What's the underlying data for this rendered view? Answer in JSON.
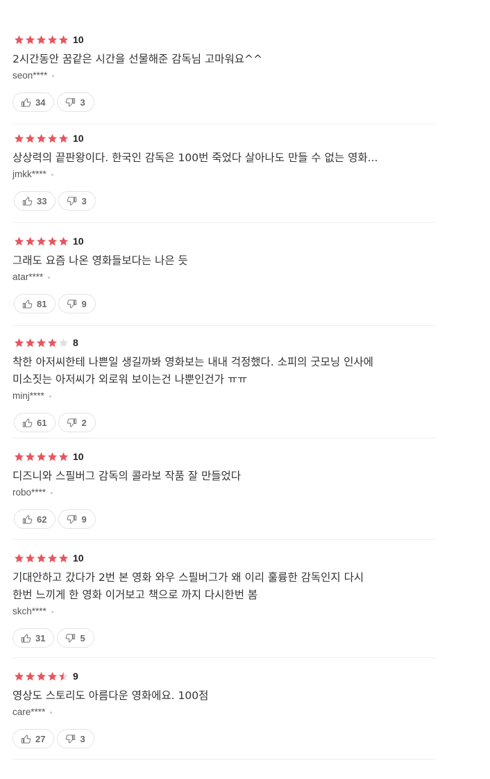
{
  "colors": {
    "star_filled": "#e8555f",
    "star_empty": "#dcdfe3",
    "divider": "#eeeeee",
    "text": "#333333"
  },
  "reviews": [
    {
      "rating_stars": 5,
      "score": "10",
      "text_lines": [
        "2시간동안 꿈같은 시간을 선물해준 감독님 고마워요^^"
      ],
      "author": "seon****",
      "like_count": "34",
      "dislike_count": "3"
    },
    {
      "rating_stars": 5,
      "score": "10",
      "text_lines": [
        "상상력의 끝판왕이다. 한국인 감독은 100번 죽었다 살아나도 만들 수 없는 영화..."
      ],
      "author": "jmkk****",
      "like_count": "33",
      "dislike_count": "3"
    },
    {
      "rating_stars": 5,
      "score": "10",
      "text_lines": [
        "그래도 요즘 나온 영화들보다는 나은 듯"
      ],
      "author": "atar****",
      "like_count": "81",
      "dislike_count": "9"
    },
    {
      "rating_stars": 4,
      "score": "8",
      "text_lines": [
        "착한 아저씨한테 나쁜일 생길까봐 영화보는 내내 걱정했다. 소피의 굿모닝 인사에",
        "미소짓는 아저씨가 외로워 보이는건 나뿐인건가 ㅠㅠ"
      ],
      "author": "minj****",
      "like_count": "61",
      "dislike_count": "2"
    },
    {
      "rating_stars": 5,
      "score": "10",
      "text_lines": [
        "디즈니와 스필버그 감독의 콜라보 작품 잘 만들었다"
      ],
      "author": "robo****",
      "like_count": "62",
      "dislike_count": "9"
    },
    {
      "rating_stars": 5,
      "score": "10",
      "text_lines": [
        "기대안하고 갔다가 2번 본 영화 와우 스필버그가 왜 이리 훌륭한 감독인지 다시",
        "한번 느끼게 한 영화 이거보고 책으로 까지 다시한번 봄"
      ],
      "author": "skch****",
      "like_count": "31",
      "dislike_count": "5"
    },
    {
      "rating_stars": 4.5,
      "score": "9",
      "text_lines": [
        "영상도 스토리도 아름다운 영화에요. 100점"
      ],
      "author": "care****",
      "like_count": "27",
      "dislike_count": "3"
    }
  ]
}
